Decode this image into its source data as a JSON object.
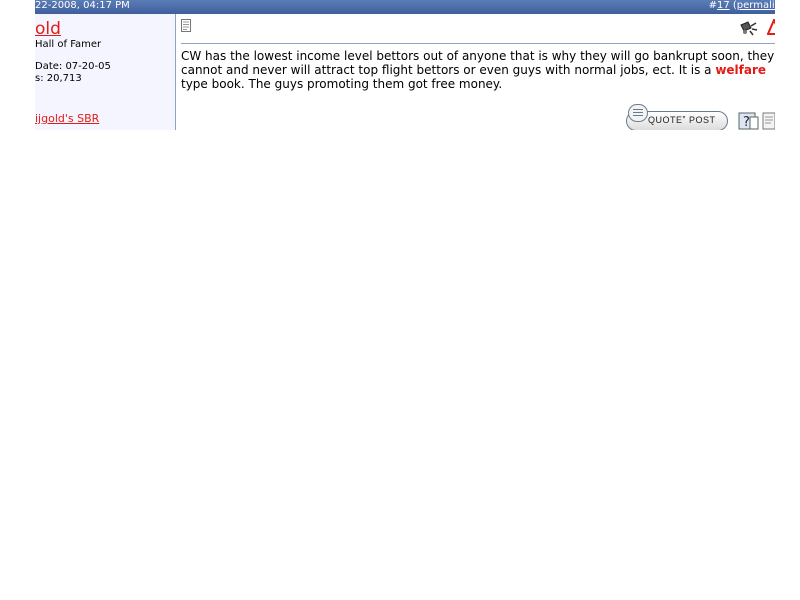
{
  "post": {
    "date": "22-2008, 04:17 PM",
    "number_prefix": "#",
    "number": "17",
    "permalink": "permalin"
  },
  "user": {
    "name": "old",
    "title": "Hall of Famer",
    "join_date": "Date: 07-20-05",
    "post_count": "s: 20,713",
    "sbr_link": "ijgold's SBR"
  },
  "message": {
    "part1": "CW has the lowest income level bettors out of anyone that is why they will go bankrupt soon, they cannot and never will attract top flight bettors or even guys with normal jobs, ect. It is a ",
    "highlight": "welfare",
    "part2": " type book. The guys promoting them got free money."
  },
  "buttons": {
    "quote_post": "QUOTEˮ POST"
  },
  "icons": {
    "post_icon": "document-icon",
    "report": "report-post-icon",
    "warn": "warning-icon",
    "quote_bubble": "speech-bubble-icon",
    "multi_quote": "multi-quote-icon",
    "quick_reply": "quick-reply-icon"
  },
  "colors": {
    "header": "#3e5f9c",
    "link_red": "#e41b17",
    "panel_bg": "#f5f5ff"
  }
}
